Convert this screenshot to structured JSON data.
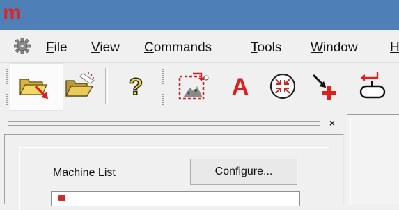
{
  "app": {
    "logo_text": "m",
    "logo_color": "#d42a2a",
    "titlebar_color": "#4f7fb7"
  },
  "menu": {
    "system_icon": "gear-icon",
    "items": [
      {
        "accel": "F",
        "rest": "ile"
      },
      {
        "accel": "V",
        "rest": "iew"
      },
      {
        "accel": "C",
        "rest": "ommands"
      },
      {
        "accel": "T",
        "rest": "ools"
      },
      {
        "accel": "W",
        "rest": "indow"
      },
      {
        "accel": "H",
        "rest": ""
      }
    ]
  },
  "toolbar": {
    "buttons": [
      {
        "icon": "open-folder-arrow-icon"
      },
      {
        "icon": "open-folder-sparkle-icon"
      },
      {
        "icon": "help-question-icon"
      },
      {
        "icon": "select-area-icon"
      },
      {
        "icon": "text-a-icon"
      },
      {
        "icon": "zoom-fit-circle-icon"
      },
      {
        "icon": "add-point-arrow-icon"
      },
      {
        "icon": "loop-return-icon"
      }
    ],
    "hovered_button": "open-folder-arrow-icon"
  },
  "panel": {
    "close_glyph": "×",
    "machine_list_label": "Machine List",
    "configure_label": "Configure..."
  }
}
